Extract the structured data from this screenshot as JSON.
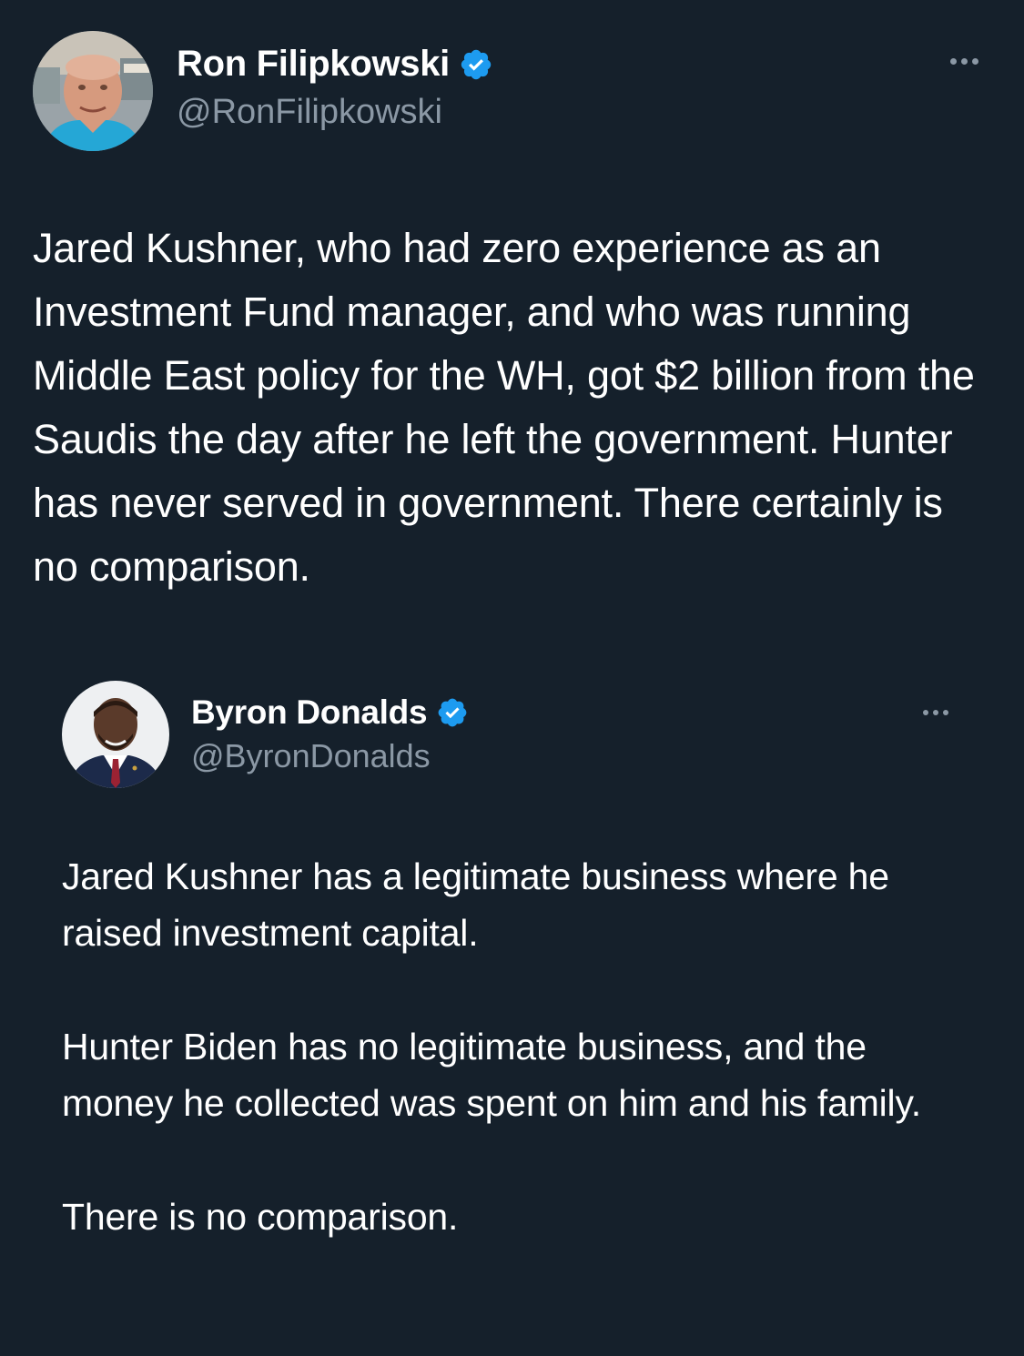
{
  "tweet": {
    "author": {
      "display_name": "Ron Filipkowski",
      "handle": "@RonFilipkowski",
      "avatar_icon": "user-avatar-photo",
      "verified_icon": "verified-badge-icon"
    },
    "more_icon": "more-options-icon",
    "text": "Jared Kushner, who had zero experience as an Investment Fund manager, and who was running Middle East policy for the WH, got $2 billion from the Saudis the day after he left the government. Hunter has never served in government. There certainly is no comparison."
  },
  "quoted_tweet": {
    "author": {
      "display_name": "Byron Donalds",
      "handle": "@ByronDonalds",
      "avatar_icon": "user-avatar-photo",
      "verified_icon": "verified-badge-icon"
    },
    "more_icon": "more-options-icon",
    "paragraphs": [
      "Jared Kushner has a legitimate business where he raised investment capital.",
      "Hunter Biden has no legitimate business, and the money he collected was spent on him and his family.",
      "There is no comparison."
    ]
  },
  "colors": {
    "background": "#15202b",
    "text_primary": "#ffffff",
    "text_secondary": "#8b98a5",
    "verified_blue": "#1d9bf0"
  }
}
